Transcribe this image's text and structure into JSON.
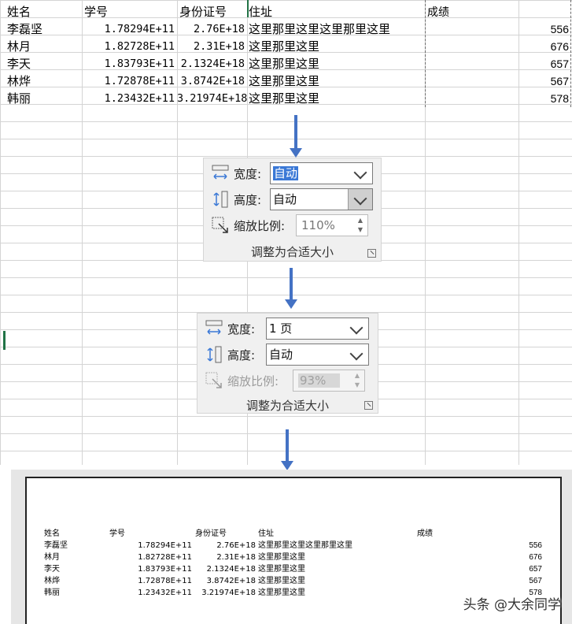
{
  "spreadsheet": {
    "headers": [
      "姓名",
      "学号",
      "身份证号",
      "住址",
      "成绩"
    ],
    "rows": [
      [
        "李磊坚",
        "1.78294E+11",
        "2.76E+18",
        "这里那里这里这里那里这里",
        "556"
      ],
      [
        "林月",
        "1.82728E+11",
        "2.31E+18",
        "这里那里这里",
        "676"
      ],
      [
        "李天",
        "1.83793E+11",
        "2.1324E+18",
        "这里那里这里",
        "657"
      ],
      [
        "林烨",
        "1.72878E+11",
        "3.8742E+18",
        "这里那里这里",
        "567"
      ],
      [
        "韩丽",
        "1.23432E+11",
        "3.21974E+18",
        "这里那里这里",
        "578"
      ]
    ]
  },
  "panel_before": {
    "width_label": "宽度:",
    "width_value": "自动",
    "height_label": "高度:",
    "height_value": "自动",
    "scale_label": "缩放比例:",
    "scale_value": "110%",
    "group_label": "调整为合适大小"
  },
  "panel_after": {
    "width_label": "宽度:",
    "width_value": "1 页",
    "height_label": "高度:",
    "height_value": "自动",
    "scale_label": "缩放比例:",
    "scale_value": "93%",
    "group_label": "调整为合适大小"
  },
  "print_preview": {
    "headers": [
      "姓名",
      "学号",
      "身份证号",
      "住址",
      "成绩"
    ],
    "rows": [
      [
        "李磊坚",
        "1.78294E+11",
        "2.76E+18",
        "这里那里这里这里那里这里",
        "556"
      ],
      [
        "林月",
        "1.82728E+11",
        "2.31E+18",
        "这里那里这里",
        "676"
      ],
      [
        "李天",
        "1.83793E+11",
        "2.1324E+18",
        "这里那里这里",
        "657"
      ],
      [
        "林烨",
        "1.72878E+11",
        "3.8742E+18",
        "这里那里这里",
        "567"
      ],
      [
        "韩丽",
        "1.23432E+11",
        "3.21974E+18",
        "这里那里这里",
        "578"
      ]
    ]
  },
  "watermark": "头条 @大余同学",
  "colors": {
    "arrow": "#4472c4",
    "selection": "#3a78d6",
    "grid": "#d4d4d4"
  }
}
